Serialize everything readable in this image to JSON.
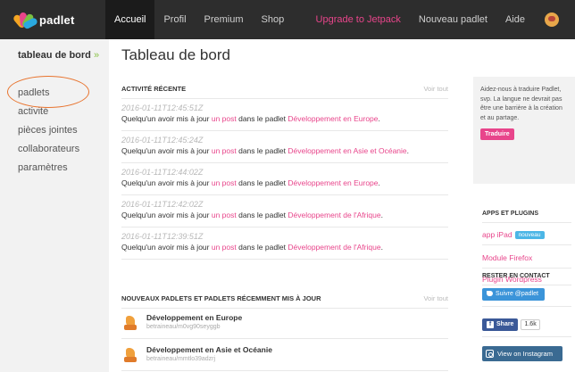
{
  "topbar": {
    "brand": "padlet",
    "nav": {
      "home": "Accueil",
      "profile": "Profil",
      "premium": "Premium",
      "shop": "Shop",
      "upgrade": "Upgrade to Jetpack",
      "new_padlet": "Nouveau padlet",
      "help": "Aide"
    }
  },
  "sidebar": {
    "title": "tableau de bord",
    "title_arrow": "»",
    "items": [
      "padlets",
      "activité",
      "pièces jointes",
      "collaborateurs",
      "paramètres"
    ]
  },
  "main": {
    "title": "Tableau de bord",
    "activity": {
      "heading": "ACTIVITÉ RÉCENTE",
      "more": "Voir tout",
      "items": [
        {
          "time": "2016-01-11T12:45:51Z",
          "prefix": "Quelqu'un avoir mis à jour ",
          "link": "un post",
          "middle": " dans le padlet ",
          "padlet": "Développement en Europe",
          "suffix": "."
        },
        {
          "time": "2016-01-11T12:45:24Z",
          "prefix": "Quelqu'un avoir mis à jour ",
          "link": "un post",
          "middle": " dans le padlet ",
          "padlet": "Développement en Asie et Océanie",
          "suffix": "."
        },
        {
          "time": "2016-01-11T12:44:02Z",
          "prefix": "Quelqu'un avoir mis à jour ",
          "link": "un post",
          "middle": " dans le padlet ",
          "padlet": "Développement en Europe",
          "suffix": "."
        },
        {
          "time": "2016-01-11T12:42:02Z",
          "prefix": "Quelqu'un avoir mis à jour ",
          "link": "un post",
          "middle": " dans le padlet ",
          "padlet": "Développement de l'Afrique",
          "suffix": "."
        },
        {
          "time": "2016-01-11T12:39:51Z",
          "prefix": "Quelqu'un avoir mis à jour ",
          "link": "un post",
          "middle": " dans le padlet ",
          "padlet": "Développement de l'Afrique",
          "suffix": "."
        }
      ]
    },
    "padlets": {
      "heading": "NOUVEAUX PADLETS ET PADLETS RÉCEMMENT MIS À JOUR",
      "more": "Voir tout",
      "items": [
        {
          "name": "Développement en Europe",
          "url": "betraineau/m0vg90seyggb"
        },
        {
          "name": "Développement en Asie et Océanie",
          "url": "betraineau/mmtlo39adzrj"
        }
      ]
    }
  },
  "right": {
    "translate_text": "Aidez-nous à traduire Padlet, svp. La langue ne devrait pas être une barrière à la création et au partage.",
    "translate_button": "Traduire",
    "apps_heading": "APPS ET PLUGINS",
    "app_ipad": "app iPad",
    "badge_new": "nouveau",
    "firefox": "Module Firefox",
    "wordpress": "Plugin Wordpress",
    "contact_heading": "RESTER EN CONTACT",
    "twitter": "Suivre @padlet",
    "fb_share": "Share",
    "fb_count": "1.6k",
    "instagram": "View on Instagram"
  }
}
